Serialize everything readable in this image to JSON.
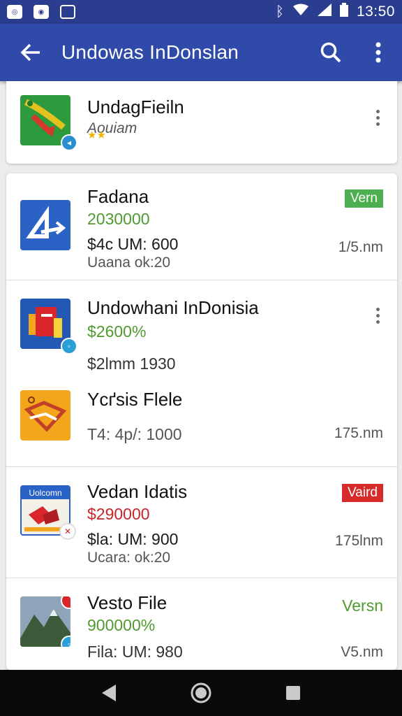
{
  "status_bar": {
    "time": "13:50"
  },
  "app_bar": {
    "title": "Undowas InDonslan"
  },
  "colors": {
    "status_bar": "#2a3d8f",
    "app_bar": "#2f4aa8",
    "green": "#4f9a2e",
    "red": "#c8242a"
  },
  "top_item": {
    "title": "UndagFieiln",
    "subtitle": "Aouiam",
    "rating_stars": 2,
    "icon": "map-app-icon"
  },
  "items": [
    {
      "title": "Fadana",
      "price": "2030000",
      "size": "$4c UM: 600",
      "sub": "Uaana ok:20",
      "right": "1/5.nm",
      "tag": "Vern",
      "icon": "arrow-app-icon"
    },
    {
      "title": "Undowhani InDonisia",
      "price": "$2600%",
      "size": "$2lmm 1930",
      "icon": "flag-app-icon"
    },
    {
      "title": "Ycґsis Flele",
      "size": "T4: 4p/: 1000",
      "right": "175.nm",
      "icon": "envelope-app-icon"
    },
    {
      "title": "Vedan Idatis",
      "price": "$290000",
      "size": "$la: UM: 900",
      "sub": "Ucara: ok:20",
      "right": "175lnm",
      "tag": "Vaird",
      "icon": "document-app-icon",
      "icon_label": "Uolcomn"
    },
    {
      "title": "Vesto File",
      "price": "900000%",
      "size": "Fila: UM: 980",
      "right": "V5.nm",
      "tag": "Versn",
      "icon": "mountain-app-icon"
    }
  ]
}
